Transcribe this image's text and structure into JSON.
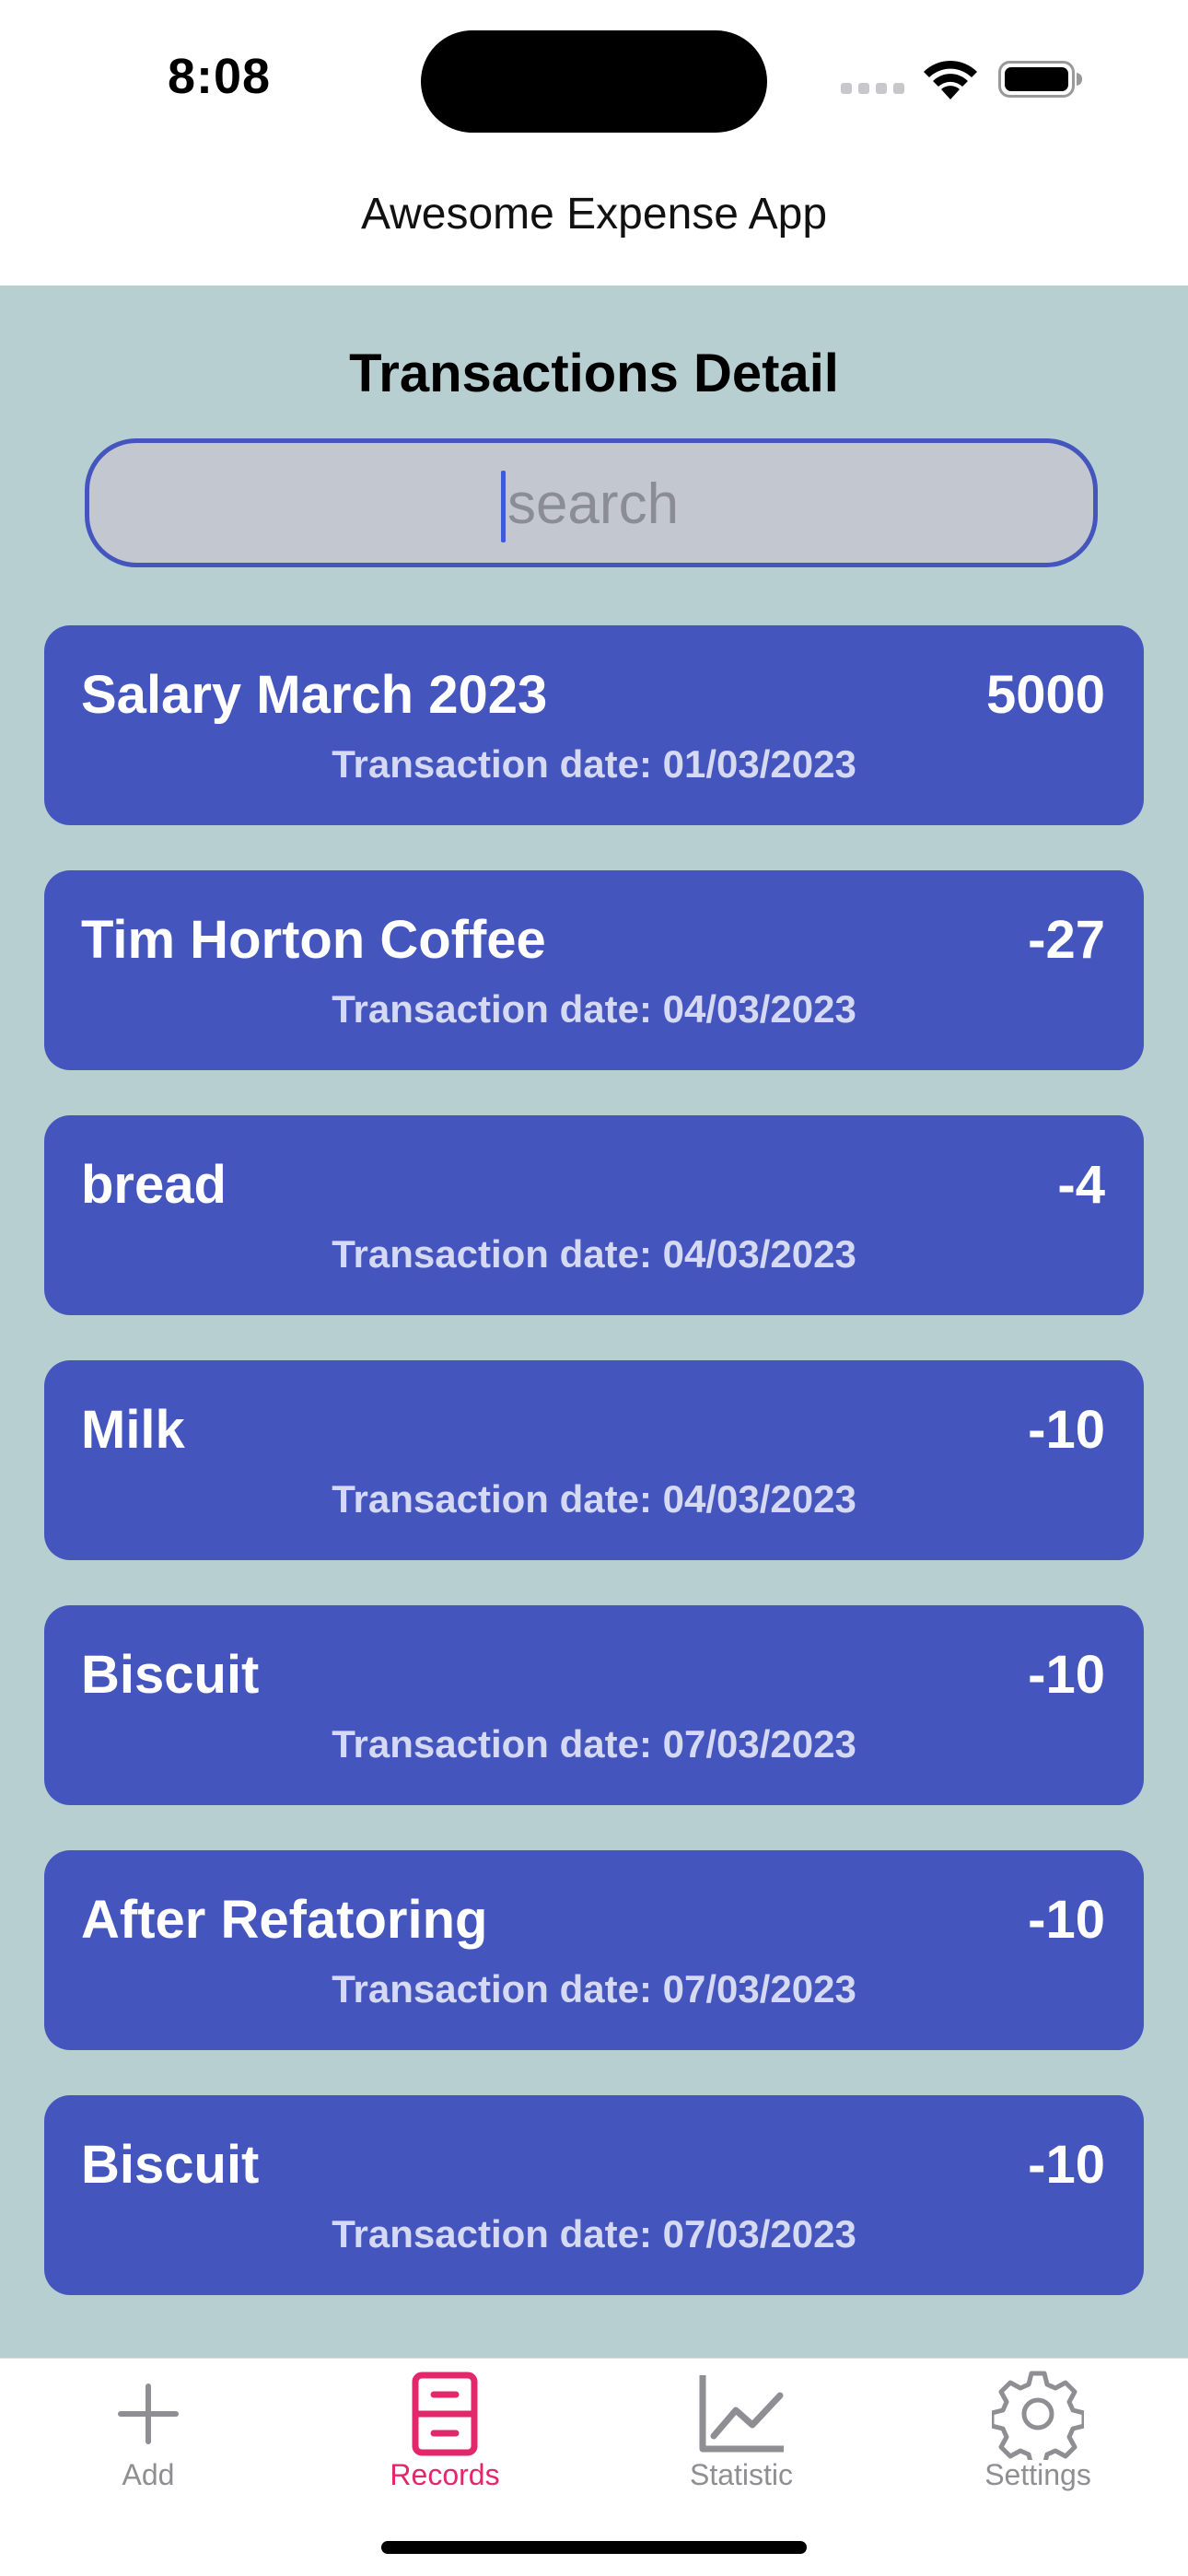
{
  "status_bar": {
    "time": "8:08"
  },
  "nav": {
    "title": "Awesome Expense App"
  },
  "main": {
    "title": "Transactions Detail",
    "search": {
      "placeholder": "search",
      "value": ""
    },
    "transactions": [
      {
        "name": "Salary March 2023",
        "amount": "5000",
        "date": "Transaction date: 01/03/2023"
      },
      {
        "name": "Tim Horton Coffee",
        "amount": "-27",
        "date": "Transaction date: 04/03/2023"
      },
      {
        "name": "bread",
        "amount": "-4",
        "date": "Transaction date: 04/03/2023"
      },
      {
        "name": "Milk",
        "amount": "-10",
        "date": "Transaction date: 04/03/2023"
      },
      {
        "name": "Biscuit",
        "amount": "-10",
        "date": "Transaction date: 07/03/2023"
      },
      {
        "name": "After Refatoring",
        "amount": "-10",
        "date": "Transaction date: 07/03/2023"
      },
      {
        "name": "Biscuit",
        "amount": "-10",
        "date": "Transaction date: 07/03/2023"
      }
    ]
  },
  "tabbar": {
    "tabs": [
      {
        "label": "Add",
        "icon": "plus-icon",
        "active": false
      },
      {
        "label": "Records",
        "icon": "records-icon",
        "active": true
      },
      {
        "label": "Statistic",
        "icon": "chart-icon",
        "active": false
      },
      {
        "label": "Settings",
        "icon": "gear-icon",
        "active": false
      }
    ]
  },
  "colors": {
    "accent": "#4455be",
    "background": "#b8cfd2",
    "active_tab": "#e2276b",
    "inactive_tab": "#8e8e93"
  }
}
